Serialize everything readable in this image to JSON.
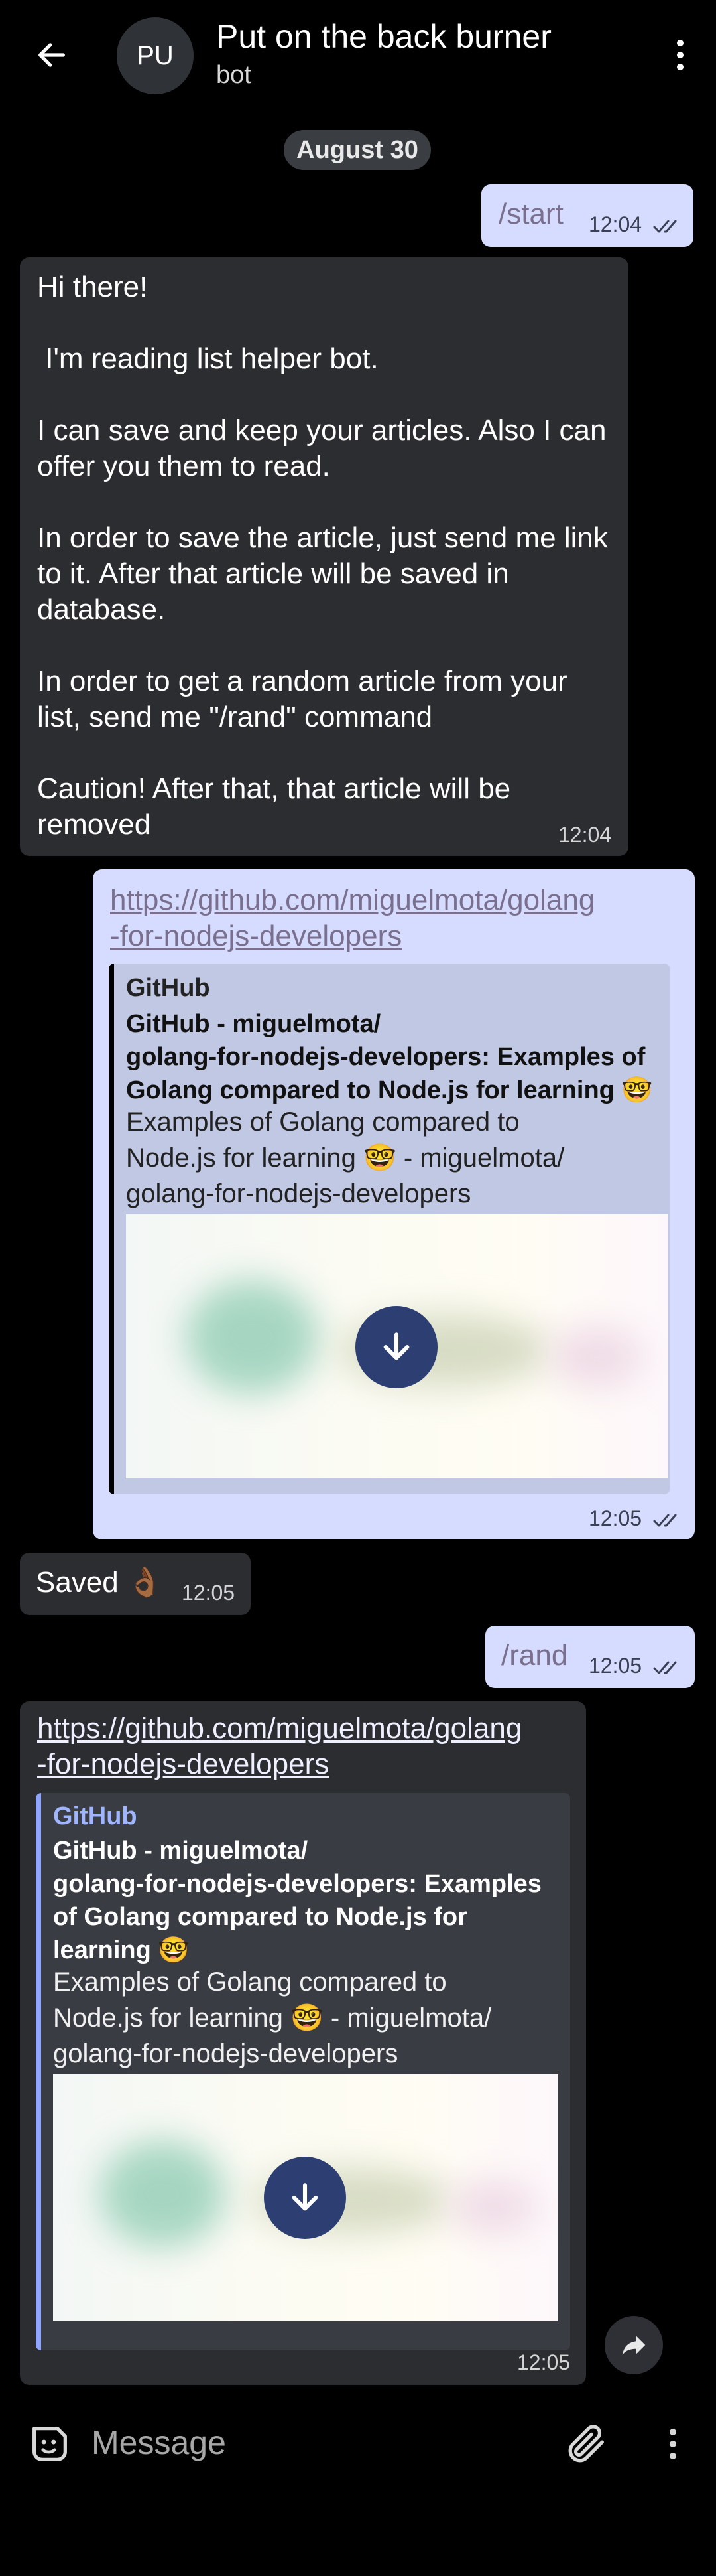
{
  "header": {
    "back_icon": "arrow-left-icon",
    "avatar_initials": "PU",
    "title": "Put on the back burner",
    "subtitle": "bot",
    "menu_icon": "more-vertical-icon"
  },
  "date_chip": "August 30",
  "messages": {
    "m1": {
      "text": "/start",
      "time": "12:04"
    },
    "m2": {
      "text": "Hi there!\n\n I'm reading list helper bot.\n\nI can save and keep your articles. Also I can offer you them to read.\n\nIn order to save the article, just send me link to it. After that article will be saved in database.\n\nIn order to get a random article from your list, send me \"/rand\" command\n\nCaution! After that, that article will be removed",
      "time": "12:04"
    },
    "m3": {
      "link": "https://github.com/miguelmota/golang-for-nodejs-developers",
      "link_line1": "https://github.com/miguelmota/golang",
      "link_line2": "-for-nodejs-developers",
      "preview_site": "GitHub",
      "preview_title": "GitHub - miguelmota/\ngolang-for-nodejs-developers: Examples of\nGolang compared to Node.js for learning 🤓",
      "preview_desc": "Examples of Golang compared to\nNode.js for learning 🤓 - miguelmota/\ngolang-for-nodejs-developers",
      "time": "12:05"
    },
    "m4": {
      "text": "Saved 👌🏾",
      "time": "12:05"
    },
    "m5": {
      "text": "/rand",
      "time": "12:05"
    },
    "m6": {
      "link_line1": "https://github.com/miguelmota/golang",
      "link_line2": "-for-nodejs-developers",
      "preview_site": "GitHub",
      "preview_title": "GitHub - miguelmota/\ngolang-for-nodejs-developers: Examples\nof Golang compared to Node.js for\nlearning 🤓",
      "preview_desc": "Examples of Golang compared to\nNode.js for learning 🤓 - miguelmota/\ngolang-for-nodejs-developers",
      "time": "12:05"
    }
  },
  "composer": {
    "placeholder": "Message",
    "emoji_icon": "sticker-emoji-icon",
    "attach_icon": "paperclip-icon",
    "more_icon": "more-vertical-icon"
  },
  "icons": {
    "share": "share-forward-icon",
    "download": "download-arrow-icon",
    "read_receipt": "double-check-icon"
  },
  "colors": {
    "background": "#000000",
    "outgoing_bubble": "#d5dcff",
    "incoming_bubble": "#2b2d31",
    "incoming_preview_accent": "#8ea4ff",
    "download_button": "#2d3f72"
  }
}
